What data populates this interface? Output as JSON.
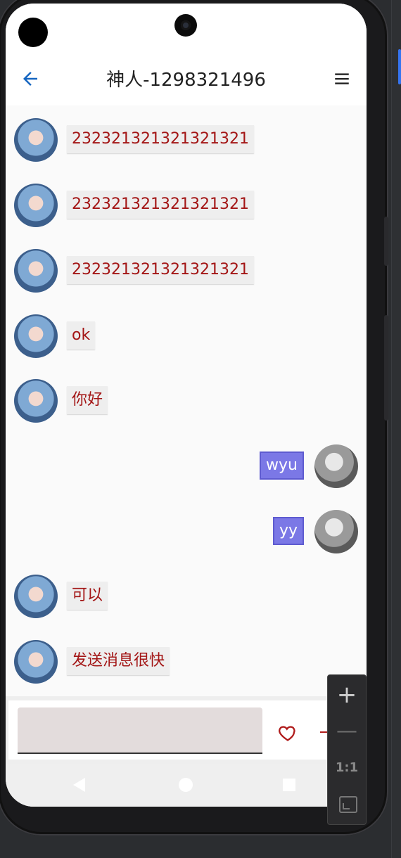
{
  "app": {
    "title": "神人-1298321496"
  },
  "messages": [
    {
      "side": "in",
      "text": "232321321321321321"
    },
    {
      "side": "in",
      "text": "232321321321321321"
    },
    {
      "side": "in",
      "text": "232321321321321321"
    },
    {
      "side": "in",
      "text": "ok"
    },
    {
      "side": "in",
      "text": "你好"
    },
    {
      "side": "out",
      "text": "wyu"
    },
    {
      "side": "out",
      "text": "yy"
    },
    {
      "side": "in",
      "text": "可以"
    },
    {
      "side": "in",
      "text": "发送消息很快"
    }
  ],
  "input": {
    "value": "",
    "placeholder": ""
  },
  "colors": {
    "incoming_text": "#a31515",
    "incoming_bubble": "#eeeeee",
    "outgoing_bubble": "#7b78e6",
    "accent": "#1565c0"
  },
  "icons": {
    "back": "arrow-left-icon",
    "menu": "hamburger-menu-icon",
    "like": "heart-outline-icon",
    "add": "plus-icon"
  },
  "emulator_toolbar": {
    "zoom_actual": "1:1"
  }
}
